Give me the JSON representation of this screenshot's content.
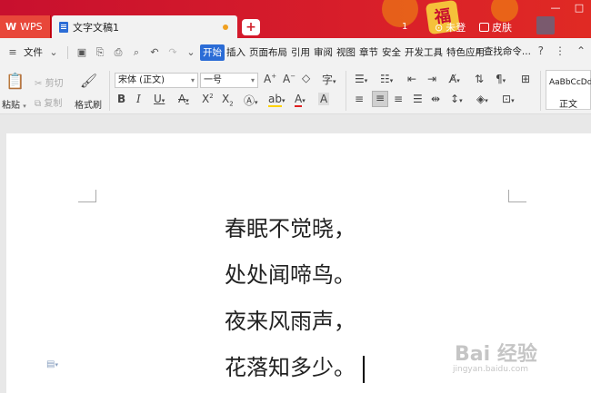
{
  "titlebar": {
    "app_tab": "WPS",
    "doc_tab": "文字文稿1",
    "new_tab": "+",
    "fu": "福",
    "count": "1",
    "login": "未登",
    "skin": "皮肤",
    "min": "—",
    "max": "□"
  },
  "menubar": {
    "file": "文件",
    "tabs": [
      "开始",
      "插入",
      "页面布局",
      "引用",
      "审阅",
      "视图",
      "章节",
      "安全",
      "开发工具",
      "特色应用"
    ],
    "search": "查找命令...",
    "help": "?"
  },
  "ribbon": {
    "paste": "粘贴",
    "cut": "剪切",
    "copy": "复制",
    "format_painter": "格式刷",
    "font_name": "宋体 (正文)",
    "font_size": "一号",
    "style_preview": "AaBbCcDd",
    "style_name": "正文"
  },
  "document": {
    "lines": [
      "春眠不觉晓，",
      "处处闻啼鸟。",
      "夜来风雨声，",
      "花落知多少。"
    ]
  },
  "watermark": {
    "brand": "Bai 经验",
    "url": "jingyan.baidu.com"
  },
  "colors": {
    "titlebar_red": "#d81e2a",
    "accent_blue": "#2b6cd6",
    "font_color_red": "#e02020"
  }
}
